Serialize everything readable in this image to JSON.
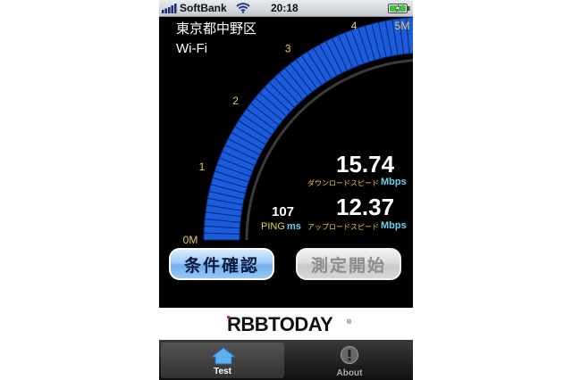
{
  "status_bar": {
    "carrier": "SoftBank",
    "time": "20:18",
    "signal_bars": 5,
    "battery_level": 1.0,
    "colors": {
      "battery": "#3fc43f"
    }
  },
  "location": {
    "area": "東京都中野区",
    "connection": "Wi-Fi"
  },
  "gauge": {
    "tick_labels": [
      "0M",
      "1",
      "2",
      "3",
      "4",
      "5M"
    ],
    "max_value": 5,
    "value": 5,
    "colors": {
      "fill": "#1a5cdc",
      "tick": "#e8c75a"
    }
  },
  "results": {
    "ping_value": "107",
    "ping_label": "PING",
    "ping_unit": "ms",
    "download_value": "15.74",
    "download_label": "ダウンロードスピード",
    "download_unit": "Mbps",
    "upload_value": "12.37",
    "upload_label": "アップロードスピード",
    "upload_unit": "Mbps",
    "colors": {
      "label": "#f0d040",
      "unit": "#6ad0f0"
    }
  },
  "buttons": {
    "conditions": "条件確認",
    "start": "測定開始"
  },
  "logo": {
    "text": "RBBTODAY",
    "mark": "®"
  },
  "tabs": [
    {
      "label": "Test",
      "icon": "home-icon",
      "selected": true
    },
    {
      "label": "About",
      "icon": "info-icon",
      "selected": false
    }
  ]
}
